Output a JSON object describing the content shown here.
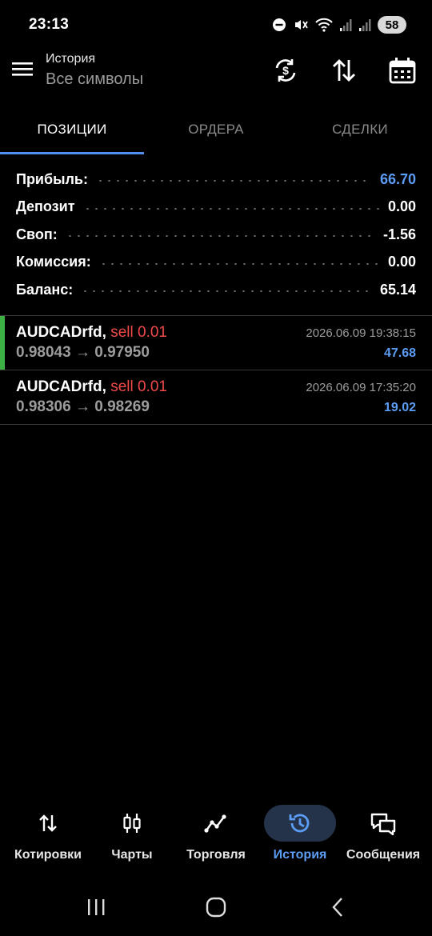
{
  "status_bar": {
    "time": "23:13",
    "battery": "58"
  },
  "header": {
    "title": "История",
    "subtitle": "Все символы",
    "icons": [
      "menu-icon",
      "currency-exchange-icon",
      "sort-icon",
      "calendar-icon"
    ]
  },
  "tabs": [
    {
      "label": "ПОЗИЦИИ",
      "active": true
    },
    {
      "label": "ОРДЕРА",
      "active": false
    },
    {
      "label": "СДЕЛКИ",
      "active": false
    }
  ],
  "summary": [
    {
      "label": "Прибыль:",
      "value": "66.70"
    },
    {
      "label": "Депозит",
      "value": "0.00"
    },
    {
      "label": "Своп:",
      "value": "-1.56"
    },
    {
      "label": "Комиссия:",
      "value": "0.00"
    },
    {
      "label": "Баланс:",
      "value": "65.14"
    }
  ],
  "deals": [
    {
      "symbol": "AUDCADrfd,",
      "side": "sell 0.01",
      "prices": "0.98043 → 0.97950",
      "time": "2026.06.09 19:38:15",
      "profit": "47.68"
    },
    {
      "symbol": "AUDCADrfd,",
      "side": "sell 0.01",
      "prices": "0.98306 → 0.98269",
      "time": "2026.06.09 17:35:20",
      "profit": "19.02"
    }
  ],
  "bottom_nav": [
    {
      "label": "Котировки",
      "icon": "quotes-icon",
      "active": false
    },
    {
      "label": "Чарты",
      "icon": "candles-icon",
      "active": false
    },
    {
      "label": "Торговля",
      "icon": "trade-icon",
      "active": false
    },
    {
      "label": "История",
      "icon": "history-icon",
      "active": true
    },
    {
      "label": "Сообщения",
      "icon": "messages-icon",
      "active": false
    }
  ],
  "colors": {
    "accent": "#5b9cf4",
    "sell": "#ef4a4a",
    "position_marker": "#3cb043",
    "background": "#000000"
  }
}
